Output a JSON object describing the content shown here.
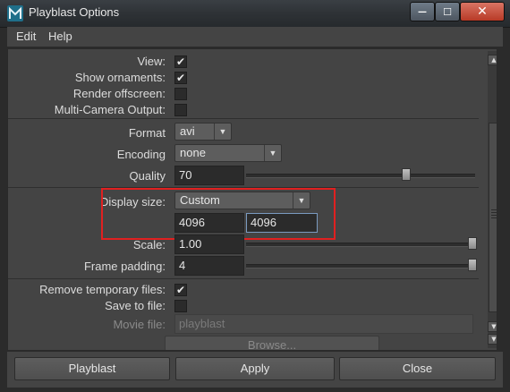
{
  "window": {
    "title": "Playblast Options",
    "close_glyph": "✕",
    "min_glyph": "—",
    "max_glyph": "☐"
  },
  "menu": [
    "Edit",
    "Help"
  ],
  "options": {
    "view": {
      "label": "View:",
      "checked": true
    },
    "show_ornaments": {
      "label": "Show ornaments:",
      "checked": true
    },
    "render_offscreen": {
      "label": "Render offscreen:",
      "checked": false
    },
    "multi_camera": {
      "label": "Multi-Camera Output:",
      "checked": false
    },
    "format": {
      "label": "Format",
      "value": "avi"
    },
    "encoding": {
      "label": "Encoding",
      "value": "none"
    },
    "quality": {
      "label": "Quality",
      "value": "70",
      "level": 0.7
    },
    "display_size": {
      "label": "Display size:",
      "value": "Custom",
      "width": "4096",
      "height": "4096"
    },
    "scale": {
      "label": "Scale:",
      "value": "1.00",
      "level": 1.0
    },
    "frame_padding": {
      "label": "Frame padding:",
      "value": "4",
      "level": 1.0
    },
    "remove_temp": {
      "label": "Remove temporary files:",
      "checked": true
    },
    "save_to_file": {
      "label": "Save to file:",
      "checked": false
    },
    "movie_file": {
      "label": "Movie file:",
      "placeholder": "playblast"
    },
    "browse": {
      "label": "Browse..."
    }
  },
  "buttons": {
    "playblast": "Playblast",
    "apply": "Apply",
    "close": "Close"
  },
  "colors": {
    "highlight": "#e02020",
    "close_button": "#c8412c"
  },
  "check_glyph": "✔"
}
